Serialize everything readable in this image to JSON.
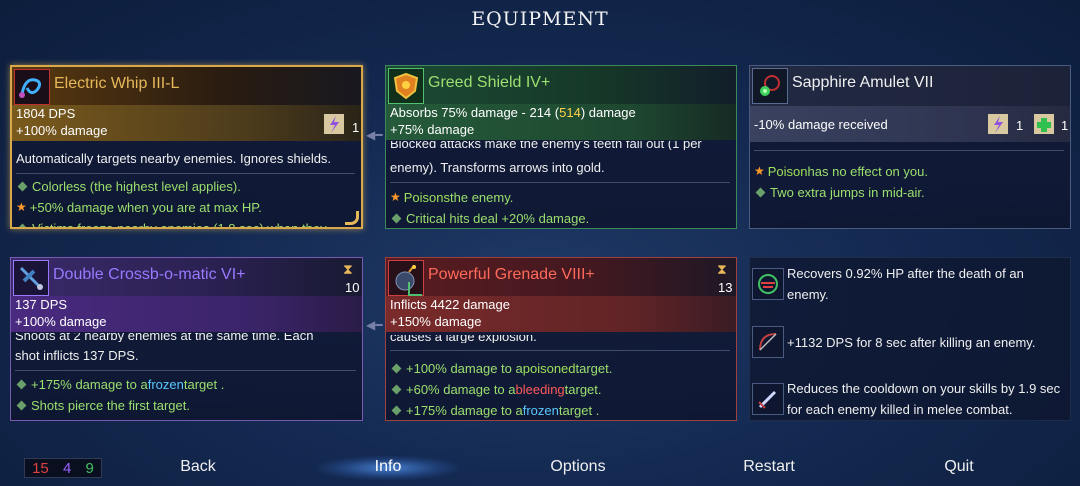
{
  "screen_title": "EQUIPMENT",
  "colors": {
    "gold": "#e6b85a",
    "green_item": "#9bdf6e",
    "purple": "#9a78ff",
    "red": "#ff6a5a",
    "poison": "#9ee05a",
    "frozen": "#5ac8ff",
    "bleeding": "#ff5a5a",
    "highlight_yellow": "#ffd24a"
  },
  "cards": {
    "whip": {
      "name": "Electric Whip III-L",
      "icon": "whip-icon",
      "stat1": "1804 DPS",
      "stat2": "+100% damage",
      "scroll_count": "1",
      "description": "Automatically targets nearby enemies. Ignores shields.",
      "bullet1": "Colorless (the highest level applies).",
      "bullet2": "+50% damage when you are at max HP.",
      "bullet3_cut": "Victims freeze nearby enemies (1.8 sec) when they"
    },
    "shield": {
      "name": "Greed Shield IV+",
      "icon": "shield-icon",
      "stat1_pre": "Absorbs 75% damage - 214 (",
      "stat1_hl": "514",
      "stat1_post": ") damage",
      "stat2": "+75% damage",
      "desc_cut": "Blocked attacks make the enemy's teeth fall out (1 per",
      "description2": "enemy). Transforms arrows into gold.",
      "bullet1_hl": "Poisons",
      "bullet1_rest": " the enemy.",
      "bullet2": "Critical hits deal +20% damage."
    },
    "amulet": {
      "name": "Sapphire Amulet VII",
      "icon": "amulet-icon",
      "stat1": "-10% damage received",
      "scroll1_count": "1",
      "scroll2_count": "1",
      "bullet1_hl": "Poison",
      "bullet1_rest": " has no effect on you.",
      "bullet2": "Two extra jumps in mid-air."
    },
    "crossbow": {
      "name": "Double Crossb-o-matic VI+",
      "icon": "crossbow-icon",
      "cooldown": "10",
      "stat1": "137 DPS",
      "stat2": "+100% damage",
      "desc_cut": "Shoots at 2 nearby enemies at the same time. Each",
      "description2": "shot inflicts 137 DPS.",
      "bullet1_pre": "+175% damage to a ",
      "bullet1_hl": "frozen",
      "bullet1_post": " target .",
      "bullet2": "Shots pierce the first target."
    },
    "grenade": {
      "name": "Powerful Grenade VIII+",
      "icon": "grenade-icon",
      "cooldown": "13",
      "stat1": "Inflicts 4422 damage",
      "stat2": "+150% damage",
      "desc_cut": "causes a large explosion.",
      "bullet1_pre": "+100% damage to a ",
      "bullet1_hl": "poisoned",
      "bullet1_post": " target.",
      "bullet2_pre": "+60% damage to a ",
      "bullet2_hl": "bleeding",
      "bullet2_post": " target.",
      "bullet3_pre": "+175% damage to a ",
      "bullet3_hl": "frozen",
      "bullet3_post": " target ."
    }
  },
  "mutations": [
    {
      "icon": "heal-mutation-icon",
      "text": "Recovers 0.92% HP after the death of an enemy."
    },
    {
      "icon": "bow-mutation-icon",
      "text": "+1132 DPS for 8 sec after killing an enemy."
    },
    {
      "icon": "blade-mutation-icon",
      "text": "Reduces the cooldown on your skills by 1.9 sec for each enemy killed in melee combat."
    }
  ],
  "stats_counter": {
    "brutality": "15",
    "tactics": "4",
    "survival": "9"
  },
  "menu": {
    "back": "Back",
    "info": "Info",
    "options": "Options",
    "restart": "Restart",
    "quit": "Quit"
  }
}
